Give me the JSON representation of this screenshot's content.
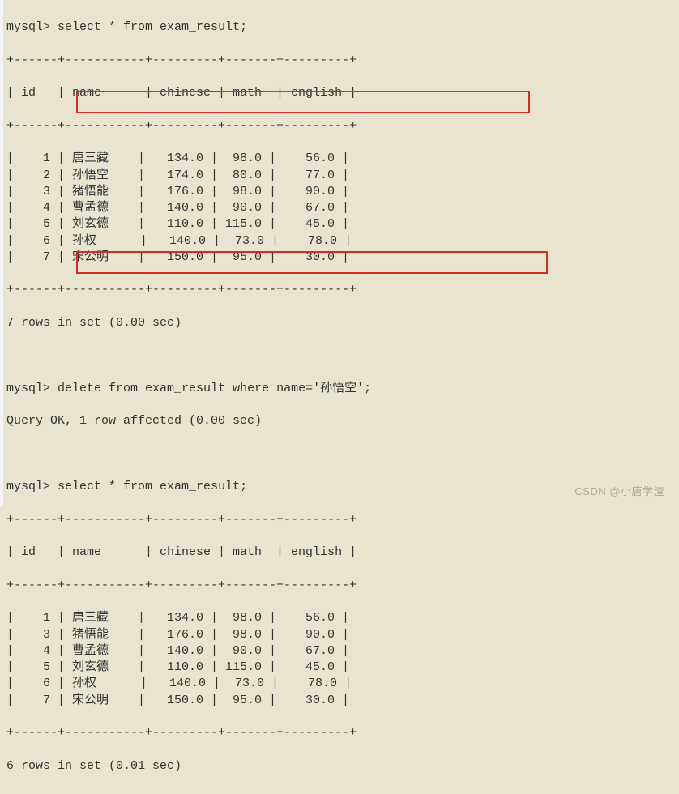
{
  "prompt": "mysql>",
  "queries": {
    "select1": "select * from exam_result;",
    "delete": "delete from exam_result where name='孙悟空';",
    "select2": "select * from exam_result;"
  },
  "separator": "+------+-----------+---------+-------+---------+",
  "header": "| id   | name      | chinese | math  | english |",
  "table1": {
    "rows": [
      {
        "id": 1,
        "name": "唐三藏",
        "chinese": "134.0",
        "math": "98.0",
        "english": "56.0"
      },
      {
        "id": 2,
        "name": "孙悟空",
        "chinese": "174.0",
        "math": "80.0",
        "english": "77.0"
      },
      {
        "id": 3,
        "name": "猪悟能",
        "chinese": "176.0",
        "math": "98.0",
        "english": "90.0"
      },
      {
        "id": 4,
        "name": "曹孟德",
        "chinese": "140.0",
        "math": "90.0",
        "english": "67.0"
      },
      {
        "id": 5,
        "name": "刘玄德",
        "chinese": "110.0",
        "math": "115.0",
        "english": "45.0"
      },
      {
        "id": 6,
        "name": "孙权",
        "chinese": "140.0",
        "math": "73.0",
        "english": "78.0"
      },
      {
        "id": 7,
        "name": "宋公明",
        "chinese": "150.0",
        "math": "95.0",
        "english": "30.0"
      }
    ],
    "footer": "7 rows in set (0.00 sec)"
  },
  "delete_result": "Query OK, 1 row affected (0.00 sec)",
  "table2": {
    "rows": [
      {
        "id": 1,
        "name": "唐三藏",
        "chinese": "134.0",
        "math": "98.0",
        "english": "56.0"
      },
      {
        "id": 3,
        "name": "猪悟能",
        "chinese": "176.0",
        "math": "98.0",
        "english": "90.0"
      },
      {
        "id": 4,
        "name": "曹孟德",
        "chinese": "140.0",
        "math": "90.0",
        "english": "67.0"
      },
      {
        "id": 5,
        "name": "刘玄德",
        "chinese": "110.0",
        "math": "115.0",
        "english": "45.0"
      },
      {
        "id": 6,
        "name": "孙权",
        "chinese": "140.0",
        "math": "73.0",
        "english": "78.0"
      },
      {
        "id": 7,
        "name": "宋公明",
        "chinese": "150.0",
        "math": "95.0",
        "english": "30.0"
      }
    ],
    "footer": "6 rows in set (0.01 sec)"
  },
  "watermark": "CSDN @小唐学渣"
}
